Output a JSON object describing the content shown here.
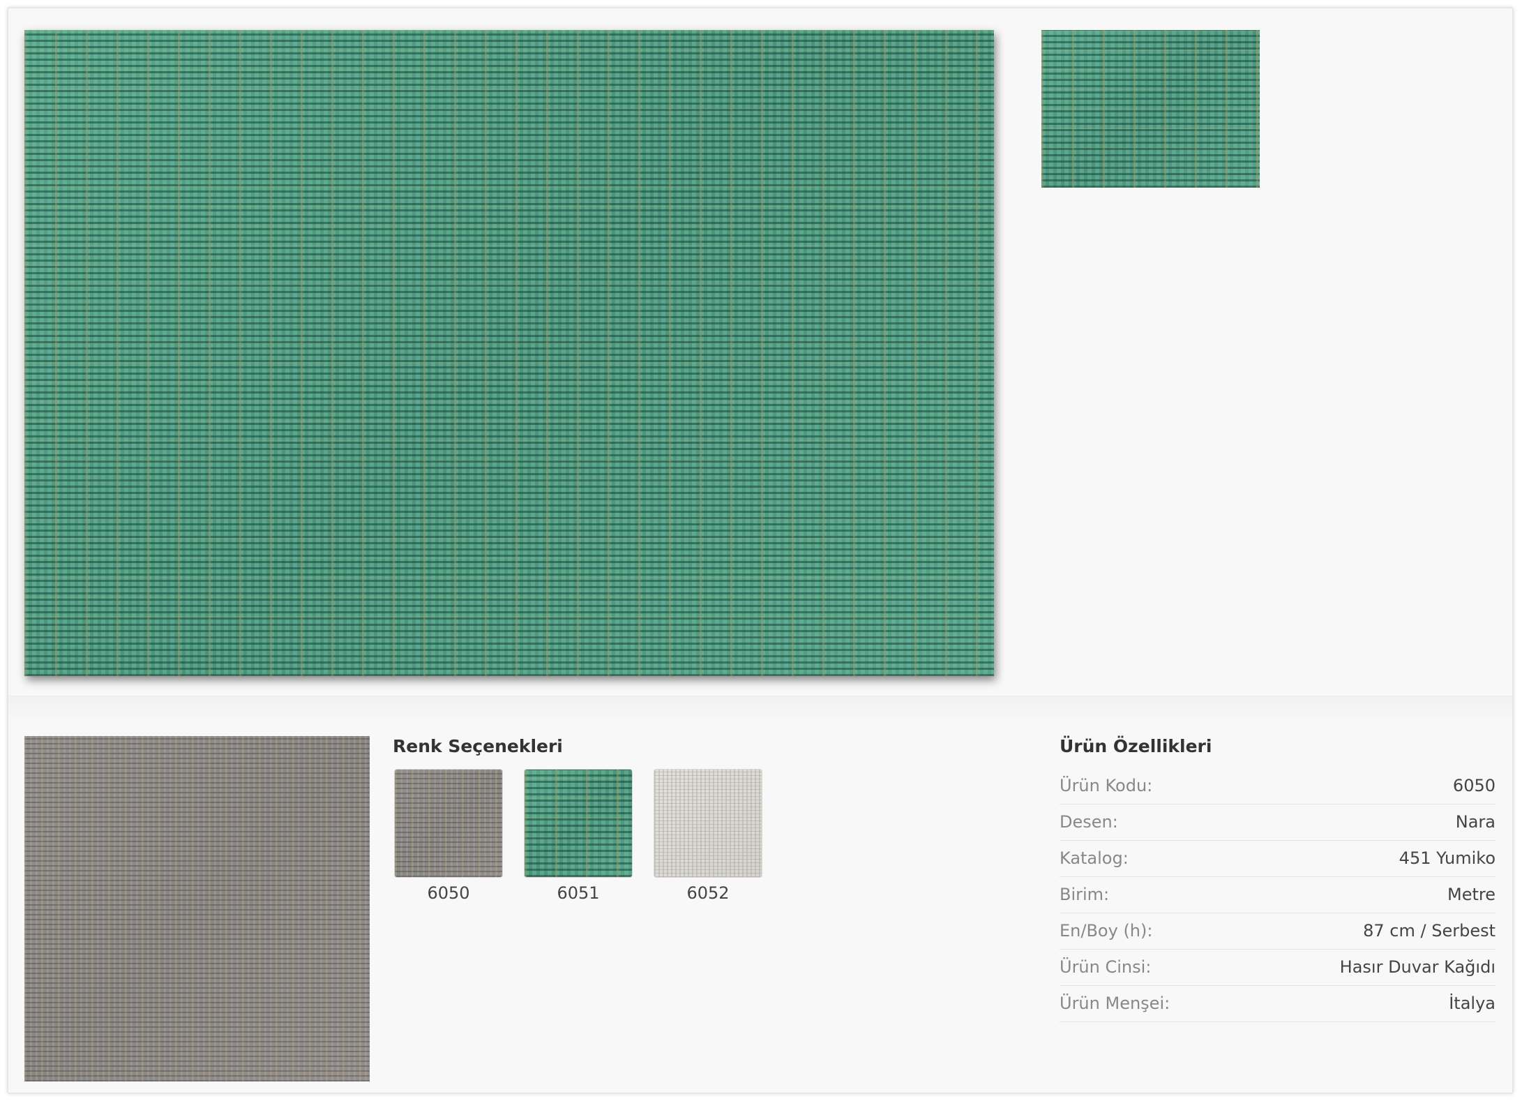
{
  "gallery": {
    "main_image": {
      "icon": "fabric-texture",
      "color": "#4e9a7e"
    },
    "thumbnail": {
      "icon": "fabric-texture",
      "color": "#4e9a7e"
    }
  },
  "selected_swatch": {
    "icon": "fabric-texture",
    "color": "#8f8a82"
  },
  "color_options": {
    "heading": "Renk Seçenekleri",
    "items": [
      {
        "code": "6050",
        "color": "#8f8a82"
      },
      {
        "code": "6051",
        "color": "#4e9a7e"
      },
      {
        "code": "6052",
        "color": "#dcdad5"
      }
    ]
  },
  "specs": {
    "heading": "Ürün Özellikleri",
    "rows": [
      {
        "label": "Ürün Kodu:",
        "value": "6050"
      },
      {
        "label": "Desen:",
        "value": "Nara"
      },
      {
        "label": "Katalog:",
        "value": "451 Yumiko"
      },
      {
        "label": "Birim:",
        "value": "Metre"
      },
      {
        "label": "En/Boy (h):",
        "value": "87 cm / Serbest"
      },
      {
        "label": "Ürün Cinsi:",
        "value": "Hasır Duvar Kağıdı"
      },
      {
        "label": "Ürün Menşei:",
        "value": "İtalya"
      }
    ]
  }
}
